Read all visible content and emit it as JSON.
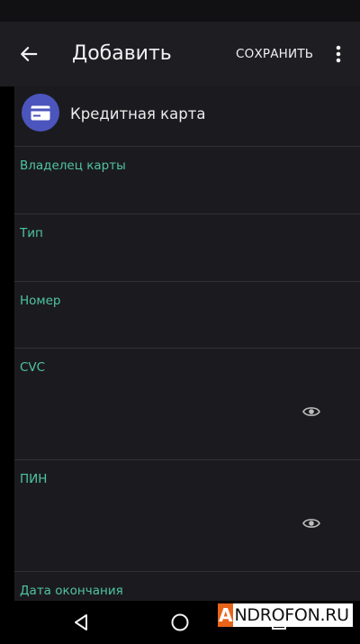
{
  "header": {
    "title": "Добавить",
    "save_label": "СОХРАНИТЬ",
    "back_icon": "arrow-left-icon",
    "more_icon": "more-vertical-icon"
  },
  "category": {
    "label": "Кредитная карта",
    "icon": "credit-card-icon",
    "color": "#4b55bd"
  },
  "fields": [
    {
      "label": "Владелец карты",
      "value": ""
    },
    {
      "label": "Тип",
      "value": ""
    },
    {
      "label": "Номер",
      "value": ""
    },
    {
      "label": "CVC",
      "value": "",
      "toggle_icon": "eye-icon"
    },
    {
      "label": "ПИН",
      "value": "",
      "toggle_icon": "eye-icon"
    },
    {
      "label": "Дата окончания",
      "value": ""
    }
  ],
  "navigation": {
    "back_icon": "triangle-back-icon",
    "home_icon": "circle-home-icon",
    "recents_icon": "square-recents-icon"
  },
  "watermark": {
    "first_letter": "A",
    "rest": "NDROFON.RU"
  },
  "colors": {
    "accent": "#4fc3a3",
    "background": "#1b1b1f",
    "app_bar": "#1d1d22"
  }
}
